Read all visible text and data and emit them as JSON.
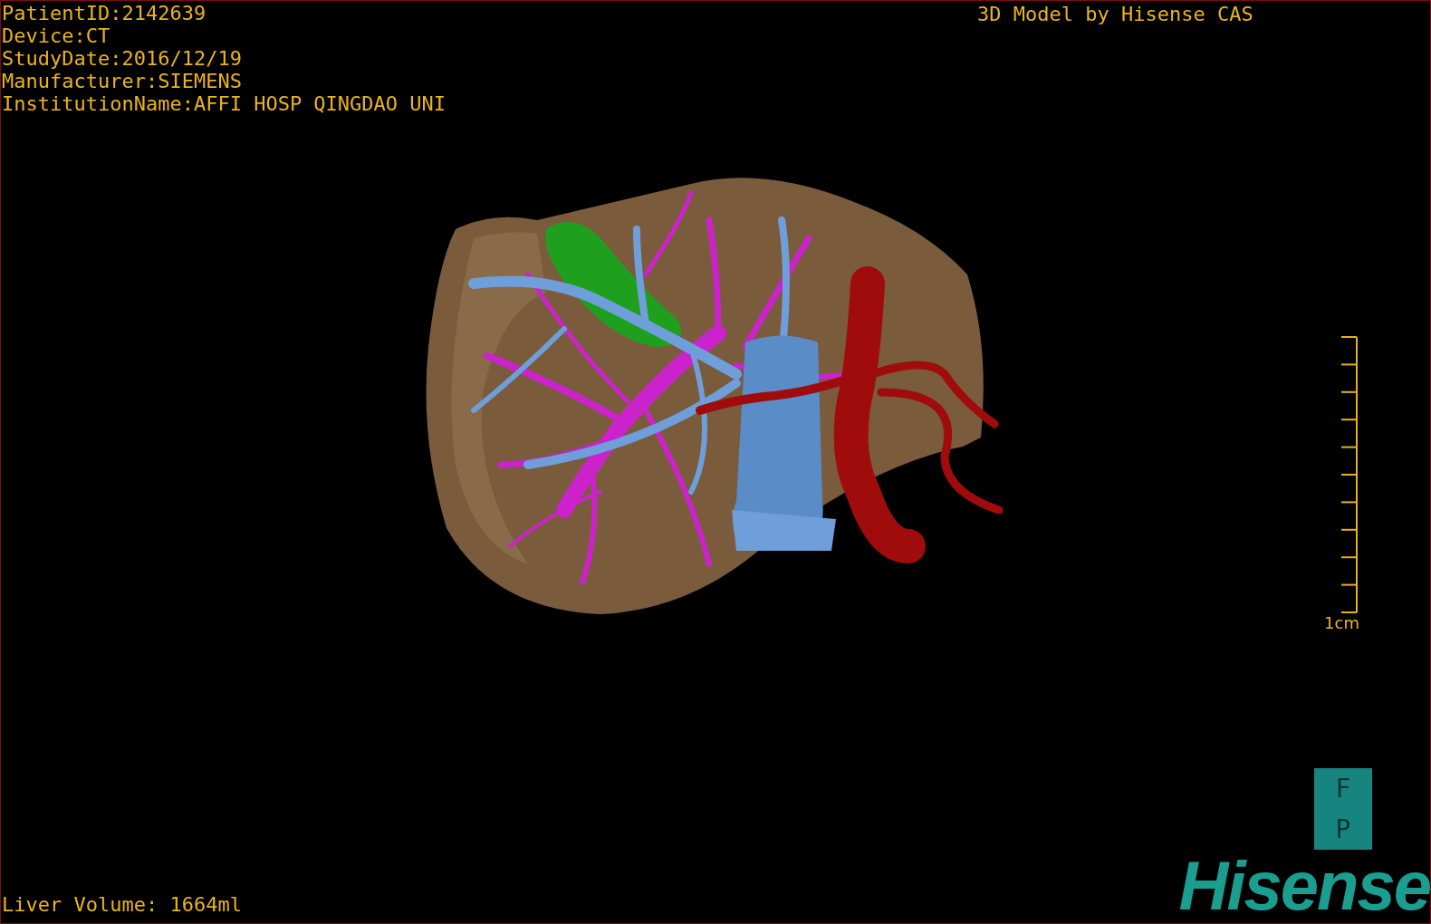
{
  "info_lines": [
    "PatientID:2142639",
    "Device:CT",
    "StudyDate:2016/12/19",
    "Manufacturer:SIEMENS",
    "InstitutionName:AFFI HOSP QINGDAO UNI"
  ],
  "title": "3D Model by Hisense CAS",
  "scale_bar": {
    "label": "1cm"
  },
  "orientation_cube": {
    "faces": [
      "F",
      "P"
    ]
  },
  "volume": "Liver Volume: 1664ml",
  "logo": "Hisense"
}
